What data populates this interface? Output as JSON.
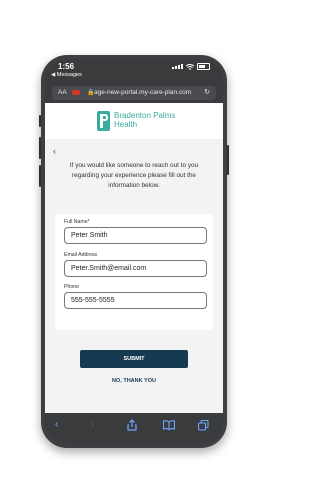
{
  "status_bar": {
    "time": "1:56",
    "back_label": "◀ Messages"
  },
  "browser": {
    "aa_label": "AA",
    "url": "age-new-portal.my-care-plan.com",
    "lock_icon": "lock-icon",
    "reload_icon": "reload-icon"
  },
  "logo": {
    "line1": "Bradenton Palms",
    "line2": "Health",
    "color": "#3aaa9f"
  },
  "intro": "If you would like someone to reach out to you regarding your experience please fill out the information below.",
  "form": {
    "full_name": {
      "label": "Full Name*",
      "value": "Peter Smith"
    },
    "email": {
      "label": "Email Address",
      "value": "Peter.Smith@email.com"
    },
    "phone": {
      "label": "Phone",
      "value": "555-555-5555"
    }
  },
  "actions": {
    "submit": "SUBMIT",
    "no_thanks": "NO, THANK YOU"
  },
  "colors": {
    "primary": "#163a52",
    "link": "#6fa4ff"
  },
  "toolbar_icons": [
    "back-icon",
    "forward-icon",
    "share-icon",
    "bookmarks-icon",
    "tabs-icon"
  ]
}
